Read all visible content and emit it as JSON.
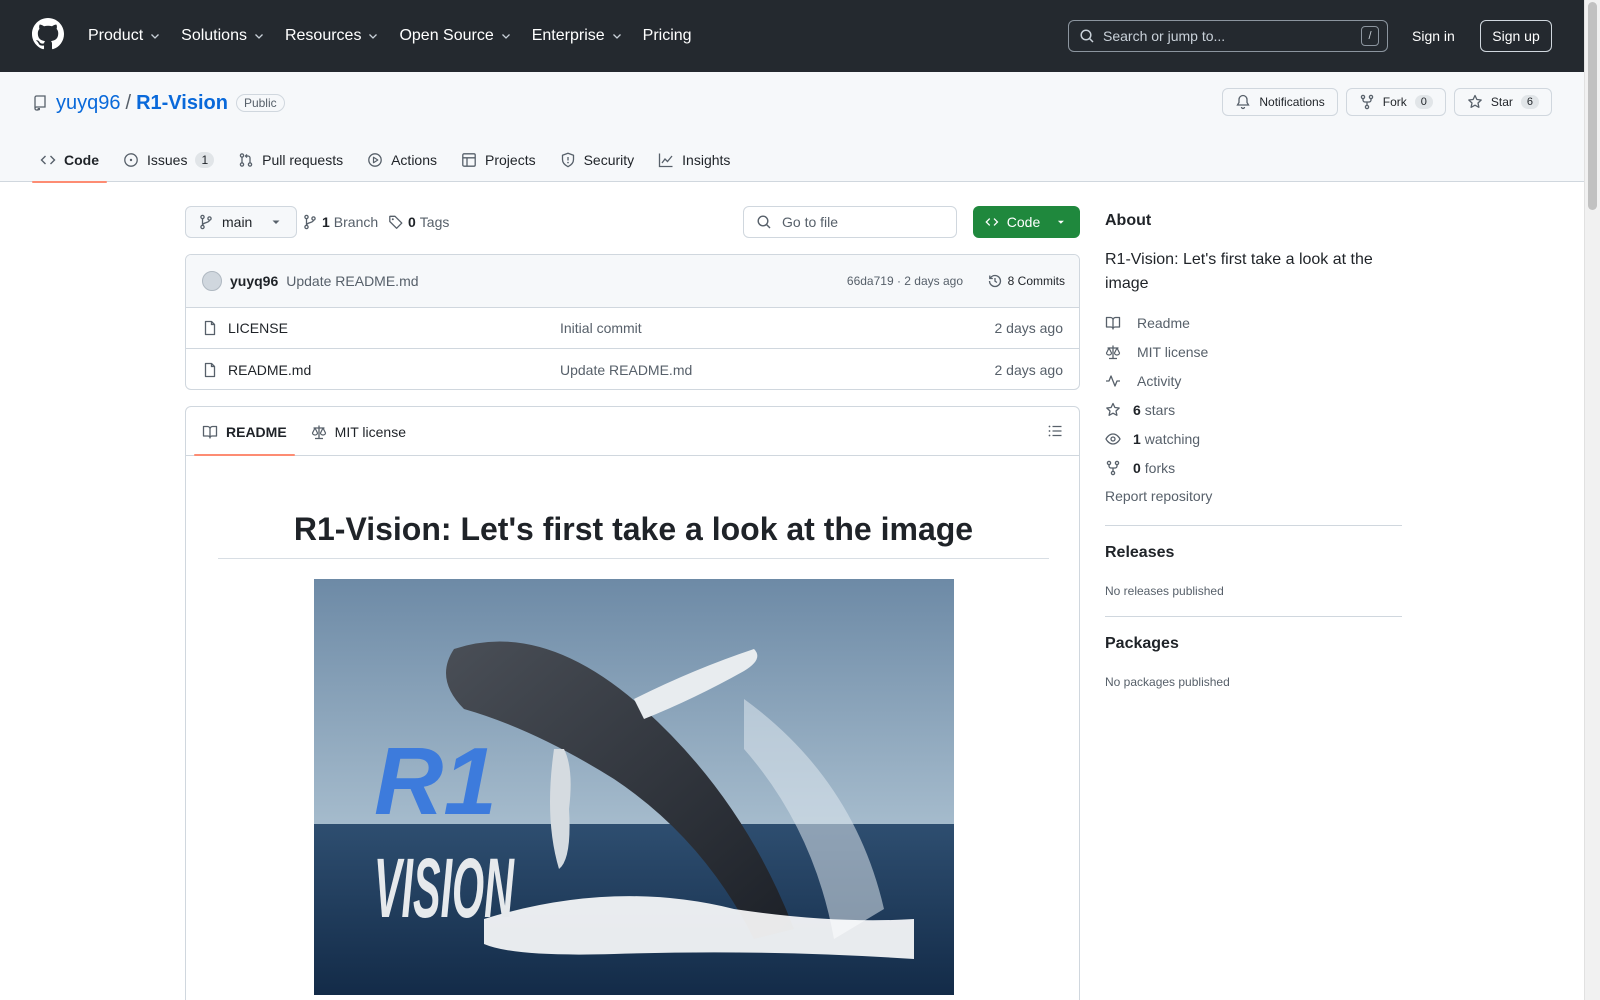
{
  "header": {
    "nav": [
      "Product",
      "Solutions",
      "Resources",
      "Open Source",
      "Enterprise",
      "Pricing"
    ],
    "search_placeholder": "Search or jump to...",
    "search_shortcut": "/",
    "sign_in": "Sign in",
    "sign_up": "Sign up"
  },
  "repo": {
    "owner": "yuyq96",
    "separator": "/",
    "name": "R1-Vision",
    "visibility": "Public",
    "notifications_label": "Notifications",
    "fork_label": "Fork",
    "fork_count": "0",
    "star_label": "Star",
    "star_count": "6"
  },
  "tabs": [
    {
      "label": "Code",
      "icon": "code-icon"
    },
    {
      "label": "Issues",
      "icon": "issue-icon",
      "count": "1"
    },
    {
      "label": "Pull requests",
      "icon": "pull-request-icon"
    },
    {
      "label": "Actions",
      "icon": "play-icon"
    },
    {
      "label": "Projects",
      "icon": "table-icon"
    },
    {
      "label": "Security",
      "icon": "shield-icon"
    },
    {
      "label": "Insights",
      "icon": "graph-icon"
    }
  ],
  "toolbar": {
    "branch": "main",
    "branch_count": "1",
    "branch_label": "Branch",
    "tag_count": "0",
    "tag_label": "Tags",
    "go_to_file": "Go to file",
    "code_button": "Code"
  },
  "latest_commit": {
    "author": "yuyq96",
    "message": "Update README.md",
    "meta": "66da719 · 2 days ago",
    "commits": "8 Commits"
  },
  "files": [
    {
      "name": "LICENSE",
      "commit": "Initial commit",
      "age": "2 days ago"
    },
    {
      "name": "README.md",
      "commit": "Update README.md",
      "age": "2 days ago"
    }
  ],
  "readme": {
    "tab_readme": "README",
    "tab_license": "MIT license",
    "heading": "R1-Vision: Let's first take a look at the image",
    "hero_logo_line1": "R1",
    "hero_logo_line2": "VISION"
  },
  "sidebar": {
    "about_title": "About",
    "about_desc": "R1-Vision: Let's first take a look at the image",
    "items": [
      {
        "icon": "book-icon",
        "strong": "",
        "label": "Readme"
      },
      {
        "icon": "law-icon",
        "strong": "",
        "label": "MIT license"
      },
      {
        "icon": "pulse-icon",
        "strong": "",
        "label": "Activity"
      },
      {
        "icon": "star-icon",
        "strong": "6",
        "label": "stars"
      },
      {
        "icon": "eye-icon",
        "strong": "1",
        "label": "watching"
      },
      {
        "icon": "fork-icon",
        "strong": "0",
        "label": "forks"
      }
    ],
    "report": "Report repository",
    "releases_title": "Releases",
    "releases_sub": "No releases published",
    "packages_title": "Packages",
    "packages_sub": "No packages published"
  },
  "colors": {
    "header_bg": "#24292f",
    "link": "#0969da",
    "primary_button": "#1f883d",
    "tab_underline": "#fd8c73"
  }
}
